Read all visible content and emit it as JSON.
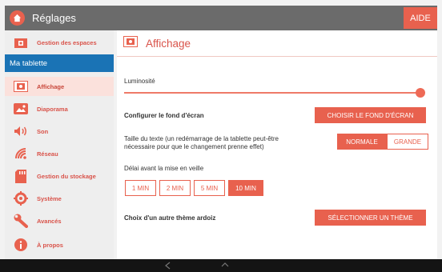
{
  "topbar": {
    "title": "Réglages",
    "help_label": "AIDE"
  },
  "sidebar": {
    "top_item": {
      "label": "Gestion des espaces",
      "icon": "folder-icon"
    },
    "section": "Ma tablette",
    "items": [
      {
        "label": "Affichage",
        "icon": "display-icon",
        "active": true
      },
      {
        "label": "Diaporama",
        "icon": "slideshow-icon"
      },
      {
        "label": "Son",
        "icon": "speaker-icon"
      },
      {
        "label": "Réseau",
        "icon": "wifi-icon"
      },
      {
        "label": "Gestion du stockage",
        "icon": "storage-icon"
      },
      {
        "label": "Système",
        "icon": "gear-icon"
      },
      {
        "label": "Avancés",
        "icon": "wrench-icon"
      },
      {
        "label": "À propos",
        "icon": "info-icon"
      }
    ]
  },
  "main": {
    "title": "Affichage",
    "brightness": {
      "label": "Luminosité",
      "level": 1.0
    },
    "wallpaper": {
      "label": "Configurer le fond d'écran",
      "button": "CHOISIR LE FOND D'ÉCRAN"
    },
    "text_size": {
      "label_line1": "Taille du texte (un redémarrage de la tablette peut-être",
      "label_line2": "nécessaire pour que le changement prenne effet)",
      "options": [
        "NORMALE",
        "GRANDE"
      ],
      "selected": "NORMALE"
    },
    "sleep": {
      "label": "Délai avant la mise en veille",
      "options": [
        "1 MIN",
        "2 MIN",
        "5 MIN",
        "10 MIN"
      ],
      "selected": "10 MIN"
    },
    "theme": {
      "label": "Choix d'un autre thème ardoiz",
      "button": "SÉLECTIONNER UN THÈME"
    }
  },
  "colors": {
    "accent": "#e8614e",
    "section_blue": "#1a73b5",
    "topbar": "#6b6b6b"
  }
}
